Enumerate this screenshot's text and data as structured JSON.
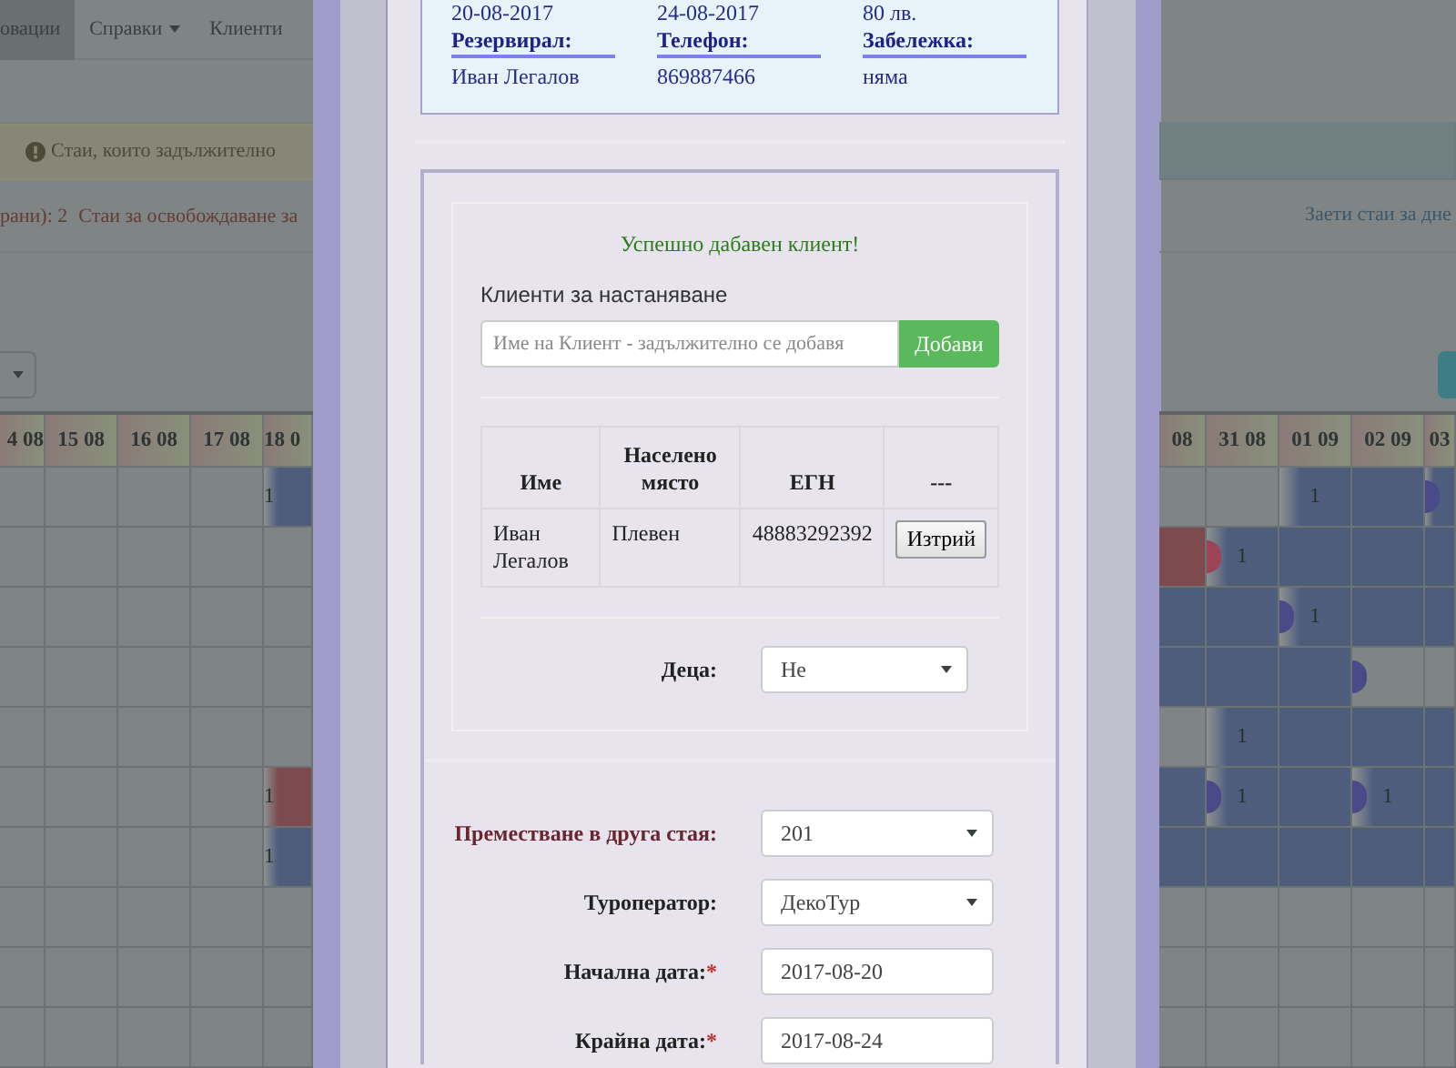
{
  "nav": {
    "items": [
      {
        "label": "овации",
        "selected": true,
        "dropdown": false
      },
      {
        "label": "Справки",
        "selected": false,
        "dropdown": true
      },
      {
        "label": "Клиенти",
        "selected": false,
        "dropdown": false
      }
    ]
  },
  "warning_alert": {
    "text": "Стаи, които задължително"
  },
  "stats_left": [
    "рани): 2",
    "Стаи за освобождаване за"
  ],
  "stats_right": "Заети стаи за дне",
  "calendar_left": {
    "columns": [
      "4 08",
      "15 08",
      "16 08",
      "17 08",
      "18 0"
    ],
    "rows": [
      [
        {
          "kind": "free"
        },
        {
          "kind": "free"
        },
        {
          "kind": "free"
        },
        {
          "kind": "free"
        },
        {
          "kind": "arrival",
          "color": "#4f5d7d",
          "label": "1"
        }
      ],
      [
        {
          "kind": "free"
        },
        {
          "kind": "free"
        },
        {
          "kind": "free"
        },
        {
          "kind": "free"
        },
        {
          "kind": "free"
        }
      ],
      [
        {
          "kind": "free"
        },
        {
          "kind": "free"
        },
        {
          "kind": "free"
        },
        {
          "kind": "free"
        },
        {
          "kind": "free"
        }
      ],
      [
        {
          "kind": "free"
        },
        {
          "kind": "free"
        },
        {
          "kind": "free"
        },
        {
          "kind": "free"
        },
        {
          "kind": "free"
        }
      ],
      [
        {
          "kind": "free"
        },
        {
          "kind": "free"
        },
        {
          "kind": "free"
        },
        {
          "kind": "free"
        },
        {
          "kind": "free"
        }
      ],
      [
        {
          "kind": "free"
        },
        {
          "kind": "free"
        },
        {
          "kind": "free"
        },
        {
          "kind": "free"
        },
        {
          "kind": "arrival",
          "color": "#7d4b4e",
          "label": "1"
        }
      ],
      [
        {
          "kind": "free"
        },
        {
          "kind": "free"
        },
        {
          "kind": "free"
        },
        {
          "kind": "free"
        },
        {
          "kind": "arrival",
          "color": "#4f5d7d",
          "label": "1"
        }
      ],
      [
        {
          "kind": "free"
        },
        {
          "kind": "free"
        },
        {
          "kind": "free"
        },
        {
          "kind": "free"
        },
        {
          "kind": "free"
        }
      ],
      [
        {
          "kind": "free"
        },
        {
          "kind": "free"
        },
        {
          "kind": "free"
        },
        {
          "kind": "free"
        },
        {
          "kind": "free"
        }
      ],
      [
        {
          "kind": "free"
        },
        {
          "kind": "free"
        },
        {
          "kind": "free"
        },
        {
          "kind": "free"
        },
        {
          "kind": "free"
        }
      ]
    ]
  },
  "calendar_right": {
    "columns": [
      "08",
      "31 08",
      "01 09",
      "02 09",
      "03"
    ],
    "rows": [
      [
        {
          "kind": "free"
        },
        {
          "kind": "free"
        },
        {
          "kind": "arrival",
          "color": "#4f5d7d",
          "label": "1"
        },
        {
          "kind": "booked",
          "color": "#4f5d7d"
        },
        {
          "kind": "turnover",
          "checkout": {
            "color": "#4b4a88"
          },
          "color": "#4f5d7d"
        }
      ],
      [
        {
          "kind": "booked",
          "color": "#7d4b4e"
        },
        {
          "kind": "turnover",
          "checkout": {
            "color": "#9e4458"
          },
          "color": "#4f5d7d",
          "label": "1"
        },
        {
          "kind": "booked",
          "color": "#4f5d7d"
        },
        {
          "kind": "booked",
          "color": "#4f5d7d"
        },
        {
          "kind": "booked",
          "color": "#4f5d7d"
        }
      ],
      [
        {
          "kind": "booked",
          "color": "#4f5d7d"
        },
        {
          "kind": "booked",
          "color": "#4f5d7d"
        },
        {
          "kind": "turnover",
          "checkout": {
            "color": "#4b4a88"
          },
          "color": "#4f5d7d",
          "label": "1"
        },
        {
          "kind": "booked",
          "color": "#4f5d7d"
        },
        {
          "kind": "booked",
          "color": "#4f5d7d"
        }
      ],
      [
        {
          "kind": "booked",
          "color": "#4f5d7d"
        },
        {
          "kind": "booked",
          "color": "#4f5d7d"
        },
        {
          "kind": "booked",
          "color": "#4f5d7d"
        },
        {
          "kind": "departure",
          "checkout": {
            "color": "#4b4a88"
          }
        },
        {
          "kind": "free"
        }
      ],
      [
        {
          "kind": "free"
        },
        {
          "kind": "arrival",
          "color": "#4f5d7d",
          "label": "1"
        },
        {
          "kind": "booked",
          "color": "#4f5d7d"
        },
        {
          "kind": "booked",
          "color": "#4f5d7d"
        },
        {
          "kind": "booked",
          "color": "#4f5d7d"
        }
      ],
      [
        {
          "kind": "booked",
          "color": "#4f5d7d"
        },
        {
          "kind": "turnover",
          "checkout": {
            "color": "#4b4a88"
          },
          "color": "#4f5d7d",
          "label": "1"
        },
        {
          "kind": "booked",
          "color": "#4f5d7d"
        },
        {
          "kind": "turnover",
          "checkout": {
            "color": "#4b4a88"
          },
          "color": "#4f5d7d",
          "label": "1"
        },
        {
          "kind": "booked",
          "color": "#4f5d7d"
        }
      ],
      [
        {
          "kind": "booked",
          "color": "#4f5d7d"
        },
        {
          "kind": "booked",
          "color": "#4f5d7d"
        },
        {
          "kind": "booked",
          "color": "#4f5d7d"
        },
        {
          "kind": "booked",
          "color": "#4f5d7d"
        },
        {
          "kind": "booked",
          "color": "#4f5d7d"
        }
      ],
      [
        {
          "kind": "free"
        },
        {
          "kind": "free"
        },
        {
          "kind": "free"
        },
        {
          "kind": "free"
        },
        {
          "kind": "free"
        }
      ],
      [
        {
          "kind": "free"
        },
        {
          "kind": "free"
        },
        {
          "kind": "free"
        },
        {
          "kind": "free"
        },
        {
          "kind": "free"
        }
      ],
      [
        {
          "kind": "free"
        },
        {
          "kind": "free"
        },
        {
          "kind": "free"
        },
        {
          "kind": "free"
        },
        {
          "kind": "free"
        }
      ]
    ]
  },
  "modal": {
    "booking_info": {
      "top_values": [
        "20-08-2017",
        "24-08-2017",
        "80 лв."
      ],
      "fields": [
        {
          "label": "Резервирал:",
          "value": "Иван Легалов"
        },
        {
          "label": "Телефон:",
          "value": "869887466"
        },
        {
          "label": "Забележка:",
          "value": "няма"
        }
      ]
    },
    "success_message": "Успешно дабавен клиент!",
    "clients_heading": "Клиенти за настаняване",
    "client_input": {
      "placeholder": "Име на Клиент - задължително се добавя"
    },
    "add_button": "Добави",
    "clients_table": {
      "columns": [
        "Име",
        "Населено място",
        "ЕГН",
        "---"
      ],
      "rows": [
        {
          "name": "Иван Легалов",
          "place": "Плевен",
          "egn": "48883292392",
          "action": "Изтрий"
        }
      ]
    },
    "children": {
      "label": "Деца:",
      "value": "Не"
    },
    "form": [
      {
        "kind": "select",
        "label": "Преместване в друга стая:",
        "emphasis": true,
        "value": "201"
      },
      {
        "kind": "select",
        "label": "Туроператор:",
        "emphasis": false,
        "value": "ДекоТур"
      },
      {
        "kind": "input",
        "label": "Начална дата:",
        "marker": "*",
        "emphasis": false,
        "value": "2017-08-20"
      },
      {
        "kind": "input",
        "label": "Крайна дата:",
        "marker": "*",
        "emphasis": false,
        "value": "2017-08-24"
      }
    ]
  }
}
